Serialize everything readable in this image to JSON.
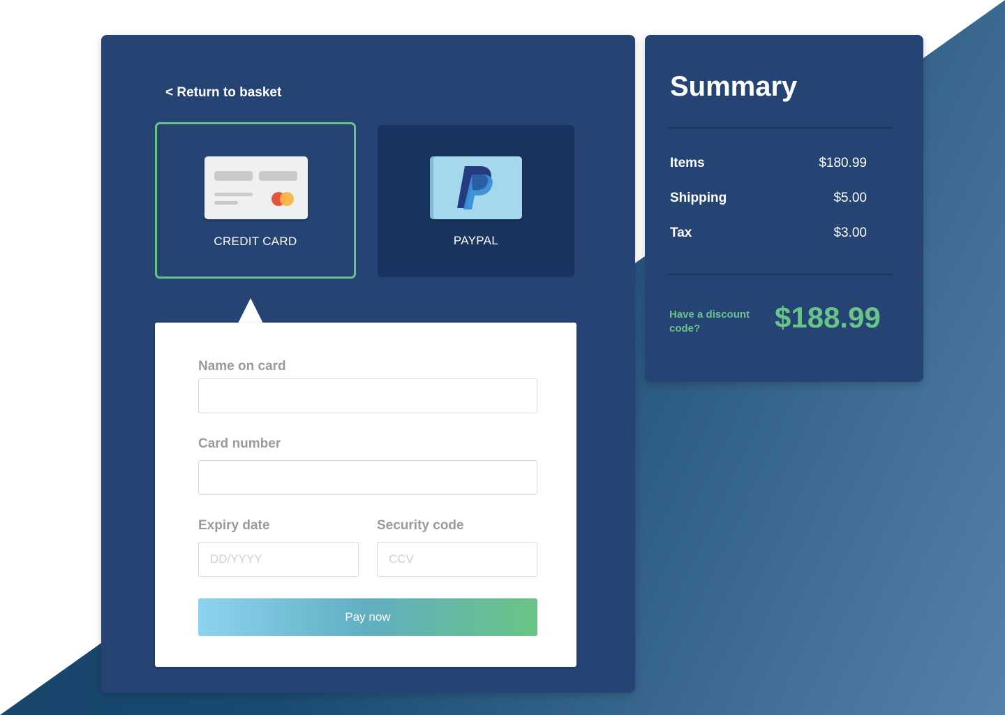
{
  "checkout": {
    "back_link": "< Return to basket",
    "methods": [
      {
        "label": "CREDIT CARD",
        "selected": true
      },
      {
        "label": "PAYPAL",
        "selected": false
      }
    ],
    "form": {
      "name_label": "Name on card",
      "name_value": "",
      "card_label": "Card number",
      "card_value": "",
      "expiry_label": "Expiry date",
      "expiry_placeholder": "DD/YYYY",
      "security_label": "Security code",
      "security_placeholder": "CCV",
      "pay_button": "Pay now"
    }
  },
  "summary": {
    "title": "Summary",
    "rows": [
      {
        "label": "Items",
        "value": "$180.99"
      },
      {
        "label": "Shipping",
        "value": "$5.00"
      },
      {
        "label": "Tax",
        "value": "$3.00"
      }
    ],
    "discount_link": "Have a discount code?",
    "total": "$188.99"
  },
  "colors": {
    "panel": "#254474",
    "accent_green": "#69c48a",
    "paypal_tile": "#19345e"
  },
  "icons": {
    "credit_card": "credit-card-icon",
    "paypal": "paypal-icon"
  }
}
